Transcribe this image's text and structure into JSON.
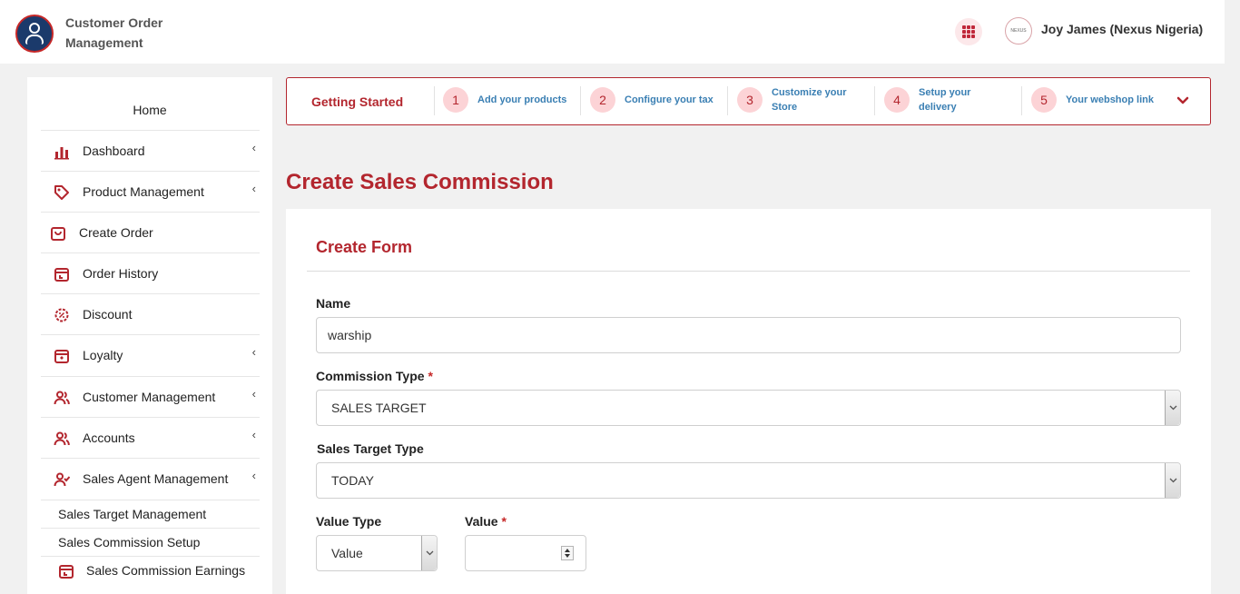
{
  "header": {
    "app_title": "Customer Order Management",
    "user_name": "Joy James (Nexus Nigeria)",
    "avatar_text": "NEXUS"
  },
  "sidebar": {
    "home": "Home",
    "items": [
      {
        "label": "Dashboard",
        "icon": "bar-chart-icon",
        "has_chevron": true
      },
      {
        "label": "Product Management",
        "icon": "tag-icon",
        "has_chevron": true
      },
      {
        "label": "Create Order",
        "icon": "shopping-bag-icon",
        "has_chevron": false
      },
      {
        "label": "Order History",
        "icon": "calendar-icon",
        "has_chevron": false
      },
      {
        "label": "Discount",
        "icon": "discount-badge-icon",
        "has_chevron": false
      },
      {
        "label": "Loyalty",
        "icon": "gift-box-icon",
        "has_chevron": true
      },
      {
        "label": "Customer Management",
        "icon": "users-icon",
        "has_chevron": true
      },
      {
        "label": "Accounts",
        "icon": "users-icon",
        "has_chevron": true
      },
      {
        "label": "Sales Agent Management",
        "icon": "user-check-icon",
        "has_chevron": true
      }
    ],
    "sub_items": [
      {
        "label": "Sales Target Management"
      },
      {
        "label": "Sales Commission Setup"
      },
      {
        "label": "Sales Commission Earnings",
        "icon": "calendar-icon"
      }
    ]
  },
  "getting_started": {
    "title": "Getting Started",
    "steps": [
      {
        "num": "1",
        "label": "Add your products"
      },
      {
        "num": "2",
        "label": "Configure your tax"
      },
      {
        "num": "3",
        "label": "Customize your Store"
      },
      {
        "num": "4",
        "label": "Setup your delivery"
      },
      {
        "num": "5",
        "label": "Your webshop link"
      }
    ]
  },
  "page": {
    "title": "Create Sales Commission"
  },
  "form": {
    "title": "Create Form",
    "name_label": "Name",
    "name_value": "warship",
    "commission_type_label": "Commission Type",
    "commission_type_value": "SALES TARGET",
    "sales_target_type_label": "Sales Target Type",
    "sales_target_type_value": "TODAY",
    "value_type_label": "Value Type",
    "value_type_value": "Value",
    "value_label": "Value",
    "value_value": "",
    "required_mark": "*"
  },
  "colors": {
    "brand_red": "#b3262e",
    "link_blue": "#3a7fb3",
    "step_badge_bg": "#fcd3d6"
  }
}
